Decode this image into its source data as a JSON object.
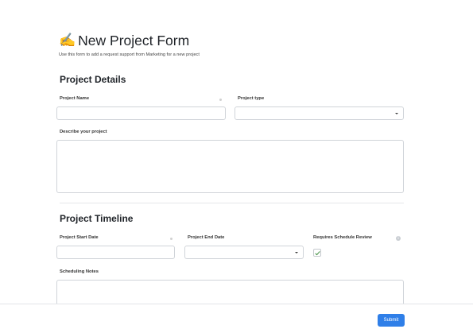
{
  "header": {
    "title_icon": "✍️",
    "title": "New Project Form",
    "subtitle": "Use this form to add a request support from Marketing for a new project"
  },
  "sections": {
    "details": "Project Details",
    "timeline": "Project Timeline"
  },
  "fields": {
    "project_name": {
      "label": "Project Name",
      "value": "",
      "required": true
    },
    "project_type": {
      "label": "Project type",
      "value": ""
    },
    "description": {
      "label": "Describe your project",
      "value": ""
    },
    "start_date": {
      "label": "Project Start Date",
      "value": "",
      "required": true
    },
    "end_date": {
      "label": "Project End Date",
      "value": ""
    },
    "schedule_review": {
      "label": "Requires Schedule Review",
      "checked": true,
      "info_icon": "info-icon"
    },
    "scheduling_notes": {
      "label": "Scheduling Notes",
      "value": ""
    }
  },
  "footer": {
    "submit_label": "Submit"
  },
  "colors": {
    "accent": "#2f7fe8",
    "check": "#3b8c3b",
    "border": "#d0d4d9"
  }
}
